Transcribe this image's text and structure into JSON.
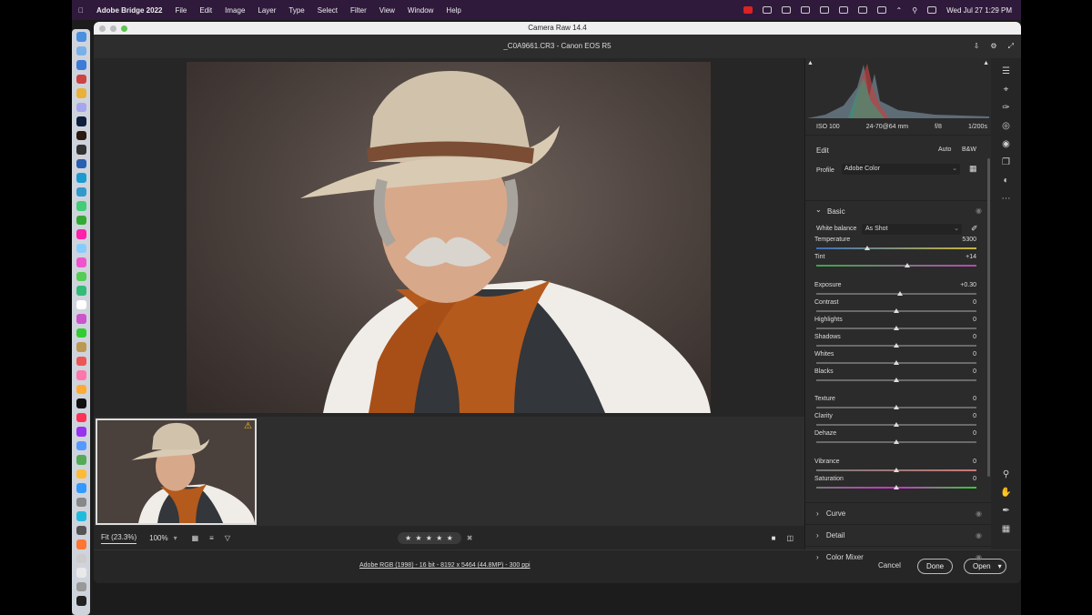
{
  "menubar": {
    "app": "Adobe Bridge 2022",
    "items": [
      "File",
      "Edit",
      "Image",
      "Layer",
      "Type",
      "Select",
      "Filter",
      "View",
      "Window",
      "Help"
    ],
    "clock": "Wed Jul 27  1:29 PM"
  },
  "window": {
    "title": "Camera Raw 14.4",
    "filename": "_C0A9661.CR3  -  Canon EOS R5"
  },
  "histogram_info": {
    "iso": "ISO 100",
    "lens": "24-70@64 mm",
    "aperture": "f/8",
    "shutter": "1/200s"
  },
  "edit": {
    "label": "Edit",
    "auto": "Auto",
    "bw": "B&W"
  },
  "profile": {
    "label": "Profile",
    "value": "Adobe Color"
  },
  "basic": {
    "title": "Basic",
    "white_balance": {
      "label": "White balance",
      "value": "As Shot"
    },
    "temperature": {
      "label": "Temperature",
      "value": "5300"
    },
    "tint": {
      "label": "Tint",
      "value": "+14"
    },
    "exposure": {
      "label": "Exposure",
      "value": "+0.30"
    },
    "contrast": {
      "label": "Contrast",
      "value": "0"
    },
    "highlights": {
      "label": "Highlights",
      "value": "0"
    },
    "shadows": {
      "label": "Shadows",
      "value": "0"
    },
    "whites": {
      "label": "Whites",
      "value": "0"
    },
    "blacks": {
      "label": "Blacks",
      "value": "0"
    },
    "texture": {
      "label": "Texture",
      "value": "0"
    },
    "clarity": {
      "label": "Clarity",
      "value": "0"
    },
    "dehaze": {
      "label": "Dehaze",
      "value": "0"
    },
    "vibrance": {
      "label": "Vibrance",
      "value": "0"
    },
    "saturation": {
      "label": "Saturation",
      "value": "0"
    }
  },
  "sections": {
    "curve": "Curve",
    "detail": "Detail",
    "color_mixer": "Color Mixer"
  },
  "bottom": {
    "fit": "Fit (23.3%)",
    "zoom": "100%",
    "stars": "★ ★ ★ ★ ★"
  },
  "status": {
    "info": "Adobe RGB (1998) - 16 bit - 8192 x 5464 (44.8MP) - 300 ppi",
    "cancel": "Cancel",
    "done": "Done",
    "open": "Open"
  },
  "colors": {
    "accent": "#2f1a3c",
    "panel": "#2b2b2b"
  }
}
